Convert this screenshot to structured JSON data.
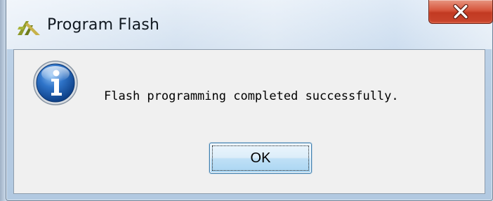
{
  "window": {
    "title": "Program Flash",
    "app_icon": "xilinx-logo-icon",
    "close_icon": "close-icon"
  },
  "dialog": {
    "icon": "info-icon",
    "message": "Flash programming completed successfully.",
    "ok_label": "OK"
  },
  "colors": {
    "close_button": "#c9452d",
    "info_icon": "#1c5fae",
    "ok_border": "#3c7fb1"
  }
}
